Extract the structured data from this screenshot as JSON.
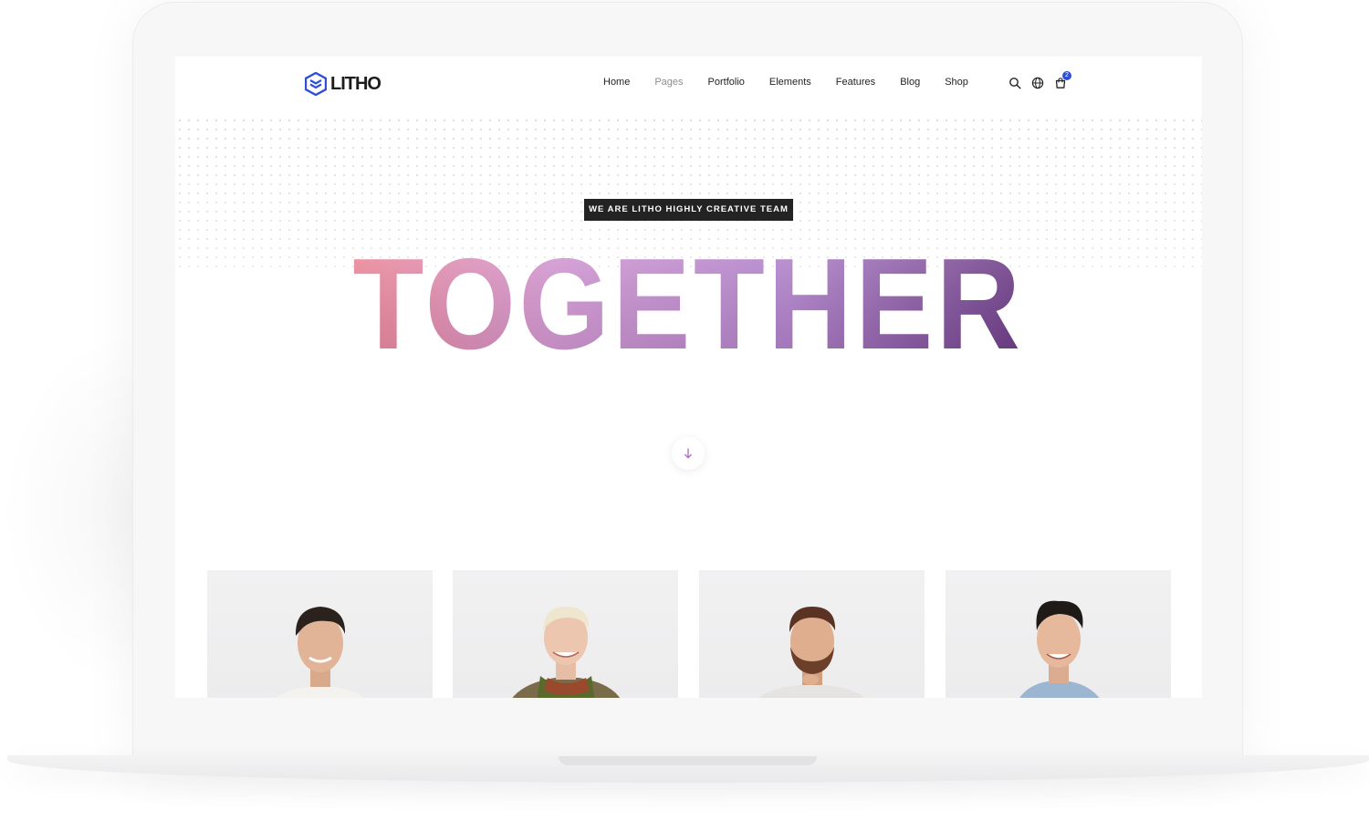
{
  "brand": {
    "name": "LITHO",
    "color": "#2f4fd6"
  },
  "nav": {
    "items": [
      {
        "label": "Home"
      },
      {
        "label": "Pages"
      },
      {
        "label": "Portfolio"
      },
      {
        "label": "Elements"
      },
      {
        "label": "Features"
      },
      {
        "label": "Blog"
      },
      {
        "label": "Shop"
      }
    ],
    "active_index": 1,
    "icons": [
      "search-icon",
      "globe-icon",
      "cart-icon"
    ],
    "cart_count": "2"
  },
  "hero": {
    "tag": "WE ARE LITHO HIGHLY CREATIVE TEAM",
    "headline": "TOGETHER",
    "gradient_colors": [
      "#f4889a",
      "#d89ad8",
      "#b483d0",
      "#6d3a88"
    ]
  },
  "team": {
    "members": [
      {
        "photo": "smiling-man-portrait"
      },
      {
        "photo": "smiling-woman-portrait"
      },
      {
        "photo": "bearded-man-portrait"
      },
      {
        "photo": "young-man-portrait"
      }
    ]
  }
}
